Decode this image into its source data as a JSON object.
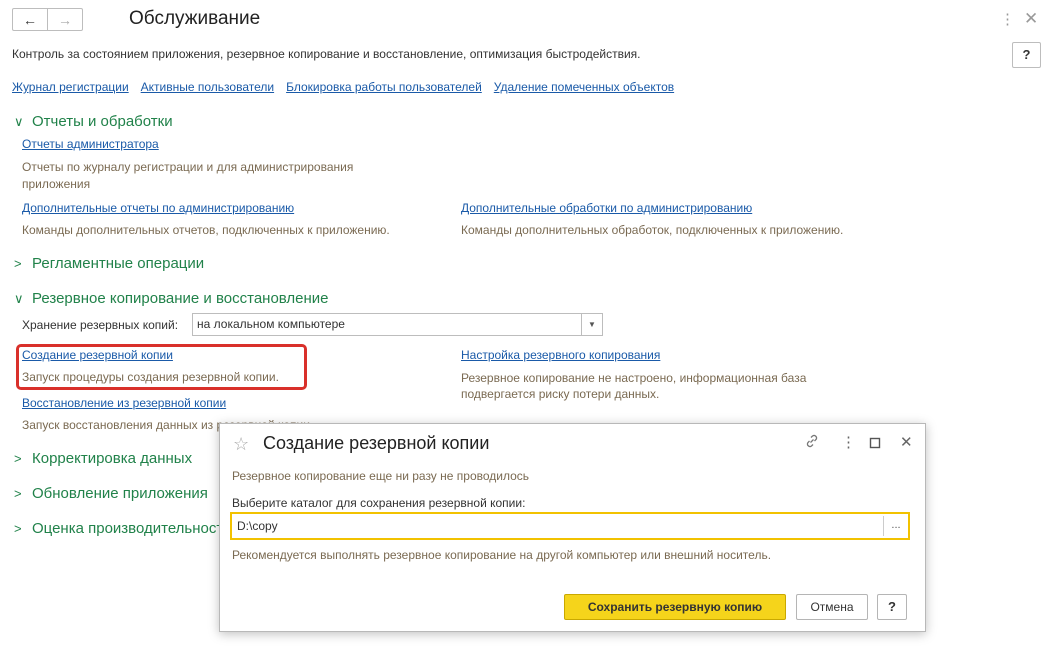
{
  "header": {
    "title": "Обслуживание",
    "back_icon": "←",
    "forward_icon": "→",
    "menu_icon": "⋮",
    "close_icon": "✕",
    "help_label": "?"
  },
  "description": "Контроль за состоянием приложения, резервное копирование и восстановление, оптимизация быстродействия.",
  "top_links": [
    "Журнал регистрации",
    "Активные пользователи",
    "Блокировка работы пользователей",
    "Удаление помеченных объектов"
  ],
  "groups": {
    "reports": {
      "title": "Отчеты и обработки",
      "expanded": true,
      "admin_reports_link": "Отчеты администратора",
      "admin_reports_desc": "Отчеты по журналу регистрации и для администрирования приложения",
      "extra_reports_link": "Дополнительные отчеты по администрированию",
      "extra_reports_desc": "Команды дополнительных отчетов, подключенных к приложению.",
      "extra_processing_link": "Дополнительные обработки по администрированию",
      "extra_processing_desc": "Команды дополнительных обработок, подключенных к приложению."
    },
    "scheduled": {
      "title": "Регламентные операции",
      "expanded": false
    },
    "backup": {
      "title": "Резервное копирование и восстановление",
      "expanded": true,
      "storage_label": "Хранение резервных копий:",
      "storage_value": "на локальном компьютере",
      "create_link": "Создание резервной копии",
      "create_desc": "Запуск процедуры создания резервной копии.",
      "settings_link": "Настройка резервного копирования",
      "settings_desc": "Резервное копирование не настроено, информационная база подвергается риску потери данных.",
      "restore_link": "Восстановление из резервной копии",
      "restore_desc": "Запуск восстановления данных из резервной копии."
    },
    "data_correction": {
      "title": "Корректировка данных",
      "expanded": false
    },
    "app_update": {
      "title": "Обновление приложения",
      "expanded": false
    },
    "performance": {
      "title": "Оценка производительности",
      "expanded": false
    }
  },
  "dialog": {
    "title": "Создание резервной копии",
    "status_text": "Резервное копирование еще ни разу не проводилось",
    "folder_label": "Выберите каталог для сохранения резервной копии:",
    "folder_value": "D:\\copy",
    "browse_label": "...",
    "hint": "Рекомендуется выполнять резервное копирование на другой компьютер или внешний носитель.",
    "save_button": "Сохранить резервную копию",
    "cancel_button": "Отмена",
    "help_button": "?"
  },
  "colors": {
    "link": "#1a5aa8",
    "group_title": "#21824a",
    "description_text": "#7a6a52",
    "highlight_border": "#d9302a",
    "primary_button": "#f5d41b",
    "focus_border": "#f2c200"
  }
}
